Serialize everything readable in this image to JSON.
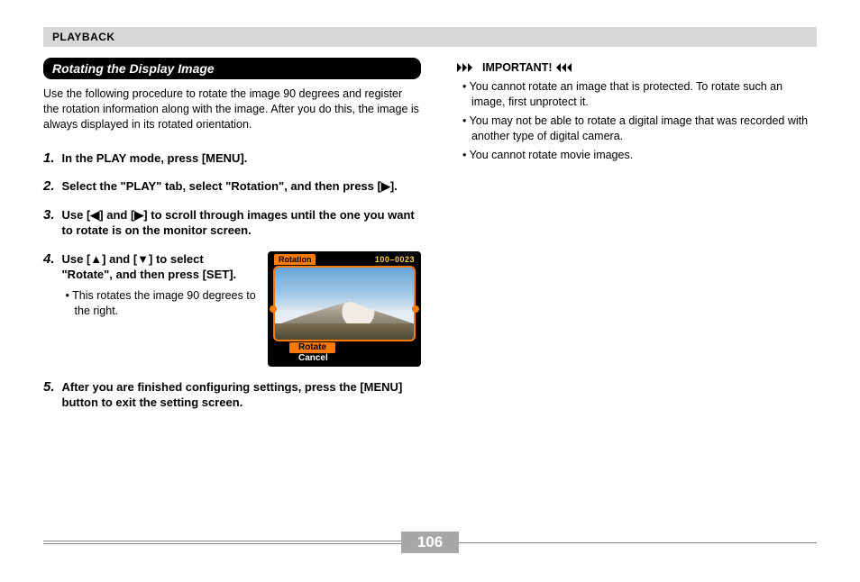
{
  "header": {
    "section": "PLAYBACK"
  },
  "left": {
    "title": "Rotating the Display Image",
    "intro": "Use the following procedure to rotate the image 90 degrees and register the rotation information along with the image. After you do this, the image is always displayed in its rotated orientation.",
    "steps": {
      "s1": {
        "n": "1.",
        "text": "In the PLAY mode, press [MENU]."
      },
      "s2": {
        "n": "2.",
        "text": "Select the \"PLAY\" tab, select \"Rotation\", and then press [▶]."
      },
      "s3": {
        "n": "3.",
        "text": "Use [◀] and [▶] to scroll through images until the one you want to rotate is on the monitor screen."
      },
      "s4": {
        "n": "4.",
        "text": "Use [▲] and [▼] to select \"Rotate\", and then press [SET].",
        "sub": "•  This rotates the image 90 degrees to the right."
      },
      "s5": {
        "n": "5.",
        "text": "After you are finished configuring settings, press the [MENU] button to exit the setting screen."
      }
    },
    "camera": {
      "tab": "Rotation",
      "id": "100–0023",
      "opt_sel": "Rotate",
      "opt": "Cancel"
    }
  },
  "right": {
    "important_label": "IMPORTANT!",
    "items": [
      "• You cannot rotate an image that is protected. To rotate such an image, first unprotect it.",
      "• You may not be able to rotate a digital image that was recorded with another type of digital camera.",
      "• You cannot rotate movie images."
    ]
  },
  "page_number": "106"
}
